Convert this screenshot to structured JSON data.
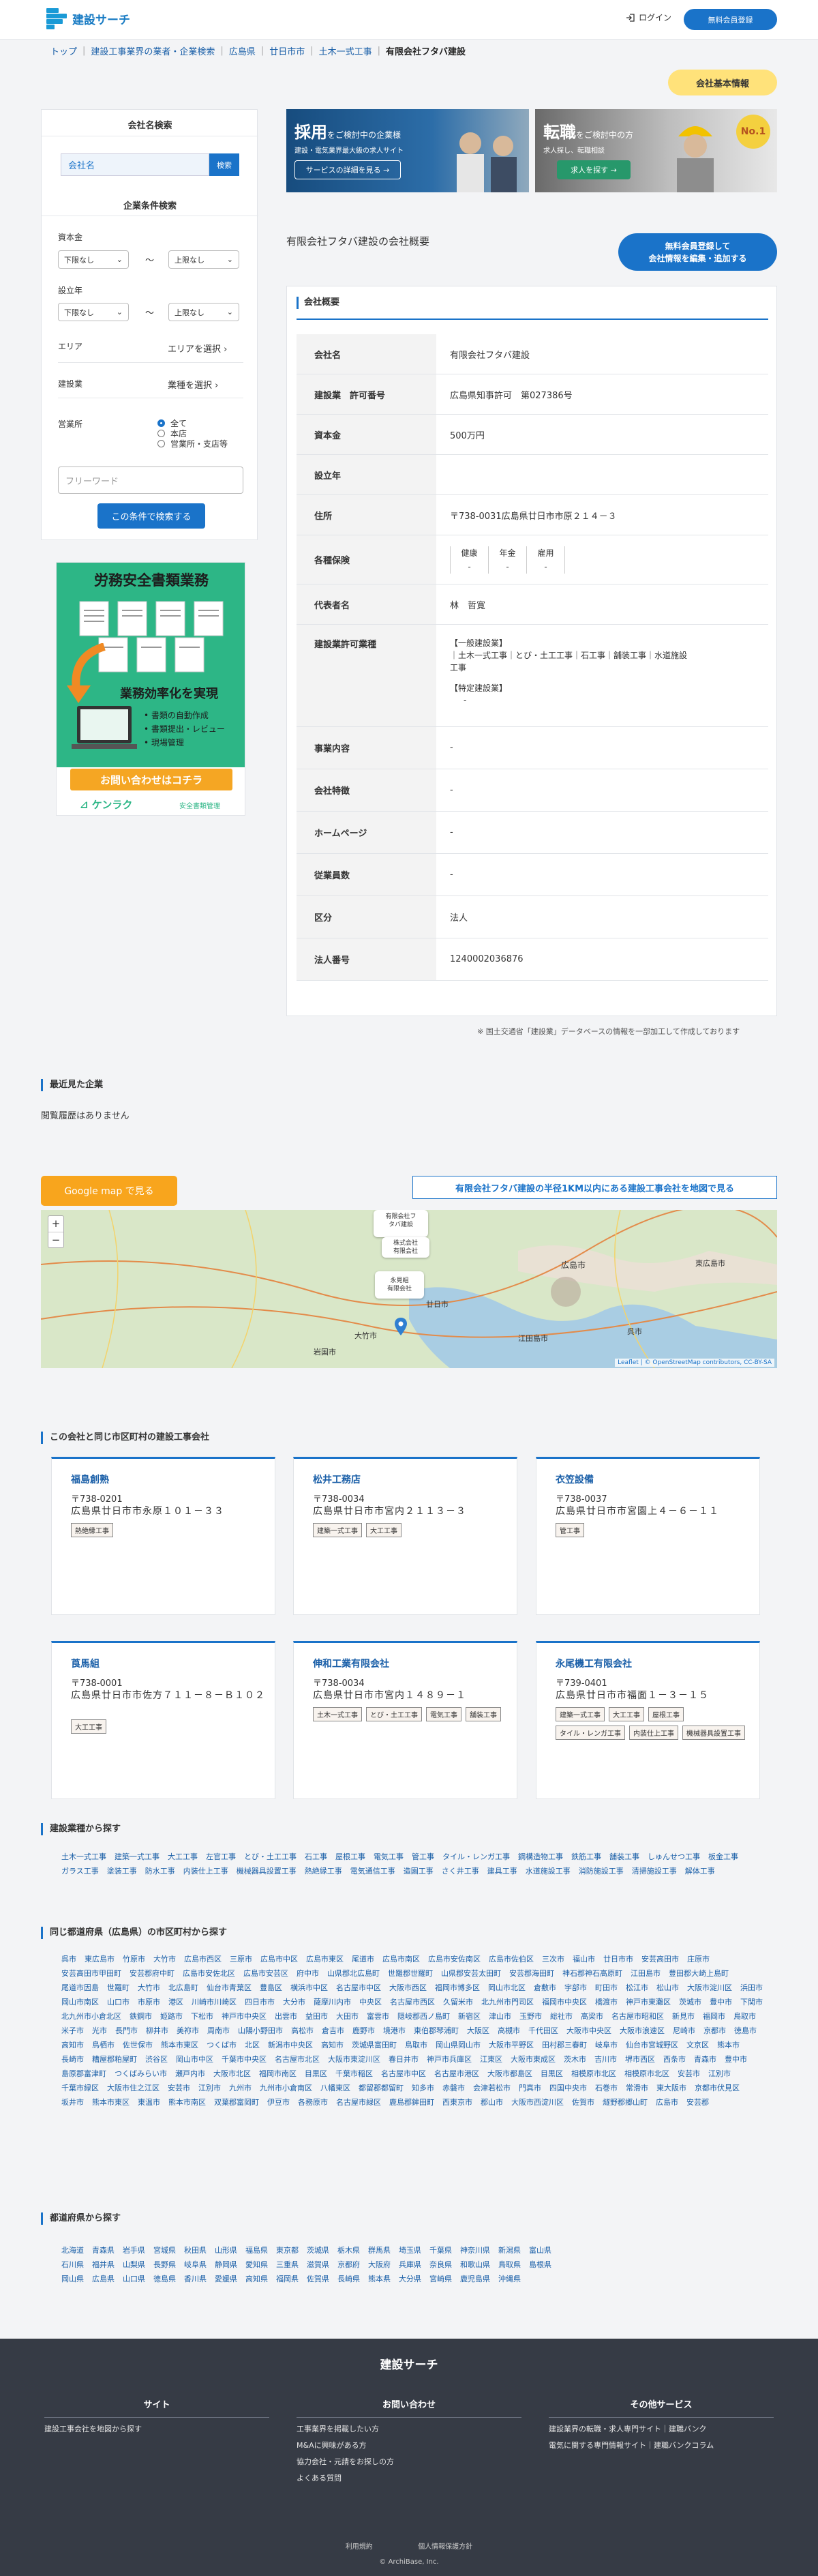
{
  "header": {
    "logo": "建設サーチ",
    "login": "ログイン",
    "register": "無料会員登録"
  },
  "breadcrumb": [
    "トップ",
    "建設工事業界の業者・企業検索",
    "広島県",
    "廿日市市",
    "土木一式工事",
    "有限会社フタバ建設"
  ],
  "info_tag": "会社基本情報",
  "sidebar": {
    "name_search_title": "会社名検索",
    "name_placeholder": "会社名",
    "name_btn": "検索",
    "cond_title": "企業条件検索",
    "capital": "資本金",
    "established": "設立年",
    "lower": "下限なし",
    "upper": "上限なし",
    "tilde": "〜",
    "area": "エリア",
    "area_choose": "エリアを選択",
    "biz": "建設業",
    "biz_choose": "業種を選択",
    "office": "営業所",
    "opt_all": "全て",
    "opt_head": "本店",
    "opt_branch": "営業所・支店等",
    "free_placeholder": "フリーワード",
    "search_btn": "この条件で検索する"
  },
  "kenraku": {
    "title": "労務安全書類業務",
    "subtitle": "業務効率化を実現",
    "bullets": [
      "書類の自動作成",
      "書類提出・レビュー",
      "現場管理"
    ],
    "cta": "お問い合わせはコチラ",
    "brand": "ケンラク",
    "brand_sub": "安全書類管理"
  },
  "ads": {
    "recruit_title_a": "採用",
    "recruit_title_b": "をご検討中の企業様",
    "recruit_sub": "建設・電気業界最大級の求人サイト",
    "recruit_btn": "サービスの詳細を見る →",
    "job_title_a": "転職",
    "job_title_b": "をご検討中の方",
    "job_sub": "求人探し、転職相談",
    "job_btn": "求人を探す →",
    "badge": "No.1"
  },
  "company_title": "有限会社フタバ建設の会社概要",
  "edit_btn_l1": "無料会員登録して",
  "edit_btn_l2": "会社情報を編集・追加する",
  "overview_label": "会社概要",
  "profile": {
    "name_k": "会社名",
    "name_v": "有限会社フタバ建設",
    "permit_k": "建設業　許可番号",
    "permit_v": "広島県知事許可　第027386号",
    "capital_k": "資本金",
    "capital_v": "500万円",
    "est_k": "設立年",
    "est_v": "",
    "addr_k": "住所",
    "addr_v": "〒738-0031広島県廿日市市原２１４－３",
    "ins_k": "各種保険",
    "ins_labels": [
      "健康",
      "年金",
      "雇用"
    ],
    "ins_vals": [
      "-",
      "-",
      "-"
    ],
    "rep_k": "代表者名",
    "rep_v": "林　哲寛",
    "lic_k": "建設業許可業種",
    "lic_general": "【一般建設業】",
    "lic_general_v1": "｜土木一式工事｜とび・土工工事｜石工事｜舗装工事｜水道施設",
    "lic_general_v2": "工事",
    "lic_special": "【特定建設業】",
    "lic_special_v": "-",
    "work_k": "事業内容",
    "work_v": "-",
    "feat_k": "会社特徴",
    "feat_v": "-",
    "hp_k": "ホームページ",
    "hp_v": "-",
    "emp_k": "従業員数",
    "emp_v": "-",
    "kind_k": "区分",
    "kind_v": "法人",
    "corp_k": "法人番号",
    "corp_v": "1240002036876"
  },
  "source_note": "※ 国土交通省「建設業」データベースの情報を一部加工して作成しております",
  "recent_title": "最近見た企業",
  "recent_empty": "閲覧履歴はありません",
  "map": {
    "gmap_btn": "Google map で見る",
    "nearby_btn": "有限会社フタバ建設の半径1KM以内にある建設工事会社を地図で見る",
    "popup1_l1": "有限会社フ",
    "popup1_l2": "タバ建設",
    "popup2_l1": "株式会社",
    "popup2_l2": "有限会社",
    "popup3_l1": "永見組",
    "popup3_l2": "有限会社",
    "attribution": "Leaflet | © OpenStreetMap contributors, CC-BY-SA",
    "labels": [
      "広島市",
      "廿日市",
      "大竹市",
      "岩国市",
      "東広島市",
      "呉市",
      "江田島市"
    ]
  },
  "nearby_title": "この会社と同じ市区町村の建設工事会社",
  "nearby": [
    {
      "name": "福島創熟",
      "zip": "〒738-0201",
      "addr": "広島県廿日市市永原１０１－３３",
      "tags": [
        "熱絶縁工事"
      ]
    },
    {
      "name": "松井工務店",
      "zip": "〒738-0034",
      "addr": "広島県廿日市市宮内２１１３－３",
      "tags": [
        "建築一式工事",
        "大工工事"
      ]
    },
    {
      "name": "衣笠設備",
      "zip": "〒738-0037",
      "addr": "広島県廿日市市宮園上４－６－１１",
      "tags": [
        "管工事"
      ]
    },
    {
      "name": "莨馬組",
      "zip": "〒738-0001",
      "addr": "広島県廿日市市佐方７１１－８－Ｂ１０２",
      "tags": [
        "大工工事"
      ]
    },
    {
      "name": "伸和工業有限会社",
      "zip": "〒738-0034",
      "addr": "広島県廿日市市宮内１４８９－１",
      "tags": [
        "土木一式工事",
        "とび・土工工事",
        "電気工事",
        "舗装工事"
      ]
    },
    {
      "name": "永尾機工有限会社",
      "zip": "〒739-0401",
      "addr": "広島県廿日市市福面１－３－１５",
      "tags": [
        "建築一式工事",
        "大工工事",
        "屋根工事",
        "タイル・レンガ工事",
        "内装仕上工事",
        "機械器具設置工事"
      ]
    }
  ],
  "by_type_title": "建設業種から探す",
  "by_type": [
    "土木一式工事",
    "建築一式工事",
    "大工工事",
    "左官工事",
    "とび・土工工事",
    "石工事",
    "屋根工事",
    "電気工事",
    "管工事",
    "タイル・レンガ工事",
    "鋼構造物工事",
    "鉄筋工事",
    "舗装工事",
    "しゅんせつ工事",
    "板金工事",
    "ガラス工事",
    "塗装工事",
    "防水工事",
    "内装仕上工事",
    "機械器具設置工事",
    "熱絶縁工事",
    "電気通信工事",
    "造園工事",
    "さく井工事",
    "建具工事",
    "水道施設工事",
    "消防施設工事",
    "清掃施設工事",
    "解体工事"
  ],
  "by_city_title": "同じ都道府県（広島県）の市区町村から探す",
  "by_city": [
    "呉市",
    "東広島市",
    "竹原市",
    "大竹市",
    "広島市西区",
    "三原市",
    "広島市中区",
    "広島市東区",
    "尾道市",
    "広島市南区",
    "広島市安佐南区",
    "広島市佐伯区",
    "三次市",
    "福山市",
    "廿日市市",
    "安芸高田市",
    "庄原市",
    "安芸高田市甲田町",
    "安芸郡府中町",
    "広島市安佐北区",
    "広島市安芸区",
    "府中市",
    "山県郡北広島町",
    "世羅郡世羅町",
    "山県郡安芸太田町",
    "安芸郡海田町",
    "神石郡神石高原町",
    "江田島市",
    "豊田郡大崎上島町",
    "尾道市因島",
    "世羅町",
    "大竹市",
    "北広島町",
    "仙台市青葉区",
    "豊島区",
    "横浜市中区",
    "名古屋市中区",
    "大阪市西区",
    "福岡市博多区",
    "岡山市北区",
    "倉敷市",
    "宇部市",
    "町田市",
    "松江市",
    "松山市",
    "大阪市淀川区",
    "浜田市",
    "岡山市南区",
    "山口市",
    "市原市",
    "港区",
    "川崎市川崎区",
    "四日市市",
    "大分市",
    "薩摩川内市",
    "中央区",
    "名古屋市西区",
    "久留米市",
    "北九州市門司区",
    "福岡市中央区",
    "橋渡市",
    "神戸市東灘区",
    "茨城市",
    "豊中市",
    "下関市",
    "北九州市小倉北区",
    "鉄鋼市",
    "姫路市",
    "下松市",
    "神戸市中央区",
    "出雲市",
    "益田市",
    "大田市",
    "富雲市",
    "隠岐郡西ノ島町",
    "新宿区",
    "津山市",
    "玉野市",
    "総社市",
    "高梁市",
    "名古屋市昭和区",
    "新見市",
    "福岡市",
    "鳥取市",
    "米子市",
    "光市",
    "長門市",
    "柳井市",
    "美祢市",
    "周南市",
    "山陽小野田市",
    "高松市",
    "倉吉市",
    "鹿野市",
    "境港市",
    "東伯郡琴浦町",
    "大阪区",
    "高槻市",
    "千代田区",
    "大阪市中央区",
    "大阪市浪速区",
    "尼崎市",
    "京都市",
    "徳島市",
    "高知市",
    "鳥栖市",
    "佐世保市",
    "熊本市東区",
    "つくば市",
    "北区",
    "新潟市中央区",
    "高知市",
    "茨城県富田町",
    "鳥取市",
    "岡山県岡山市",
    "大阪市平野区",
    "田村郡三春町",
    "岐阜市",
    "仙台市宮城野区",
    "文京区",
    "熊本市",
    "長崎市",
    "糟屋郡粕屋町",
    "渋谷区",
    "岡山市中区",
    "千葉市中央区",
    "名古屋市北区",
    "大阪市東淀川区",
    "春日井市",
    "神戸市兵庫区",
    "江東区",
    "大阪市東成区",
    "茨木市",
    "吉川市",
    "堺市西区",
    "西条市",
    "青森市",
    "豊中市",
    "島原郡富津町",
    "つくばみらい市",
    "瀬戸内市",
    "大阪市北区",
    "福岡市南区",
    "目黒区",
    "千葉市稲区",
    "名古屋市中区",
    "名古屋市港区",
    "大阪市都島区",
    "目黒区",
    "相模原市北区",
    "相模原市北区",
    "安芸市",
    "江別市",
    "千葉市緑区",
    "大阪市住之江区",
    "安芸市",
    "江別市",
    "九州市",
    "九州市小倉南区",
    "八幡東区",
    "都留郡都留町",
    "知多市",
    "赤磐市",
    "会津若松市",
    "門真市",
    "四国中央市",
    "石巻市",
    "常滑市",
    "東大阪市",
    "京都市伏見区",
    "坂井市",
    "熊本市東区",
    "東温市",
    "熊本市南区",
    "双葉郡富岡町",
    "伊豆市",
    "各務原市",
    "名古屋市緑区",
    "鹿島郡鉾田町",
    "西東京市",
    "郡山市",
    "大阪市西淀川区",
    "佐賀市",
    "燧野郡郷山町",
    "広島市",
    "安芸郡"
  ],
  "by_pref_title": "都道府県から探す",
  "by_pref": [
    "北海道",
    "青森県",
    "岩手県",
    "宮城県",
    "秋田県",
    "山形県",
    "福島県",
    "東京都",
    "茨城県",
    "栃木県",
    "群馬県",
    "埼玉県",
    "千葉県",
    "神奈川県",
    "新潟県",
    "富山県",
    "石川県",
    "福井県",
    "山梨県",
    "長野県",
    "岐阜県",
    "静岡県",
    "愛知県",
    "三重県",
    "滋賀県",
    "京都府",
    "大阪府",
    "兵庫県",
    "奈良県",
    "和歌山県",
    "鳥取県",
    "島根県",
    "岡山県",
    "広島県",
    "山口県",
    "徳島県",
    "香川県",
    "愛媛県",
    "高知県",
    "福岡県",
    "佐賀県",
    "長崎県",
    "熊本県",
    "大分県",
    "宮崎県",
    "鹿児島県",
    "沖縄県"
  ],
  "footer": {
    "title": "建設サーチ",
    "col1": "サイト",
    "col1_items": [
      "建設工事会社を地図から探す"
    ],
    "col2": "お問い合わせ",
    "col2_items": [
      "工事業界を掲載したい方",
      "M&Aに興味がある方",
      "協力会社・元請をお探しの方",
      "よくある質問"
    ],
    "col3": "その他サービス",
    "col3_items": [
      "建設業界の転職・求人専門サイト｜建職バンク",
      "電気に関する専門情報サイト｜建職バンクコラム"
    ],
    "bottom_links": [
      "利用規約",
      "個人情報保護方針"
    ],
    "copyright": "© ArchiBase, Inc."
  }
}
